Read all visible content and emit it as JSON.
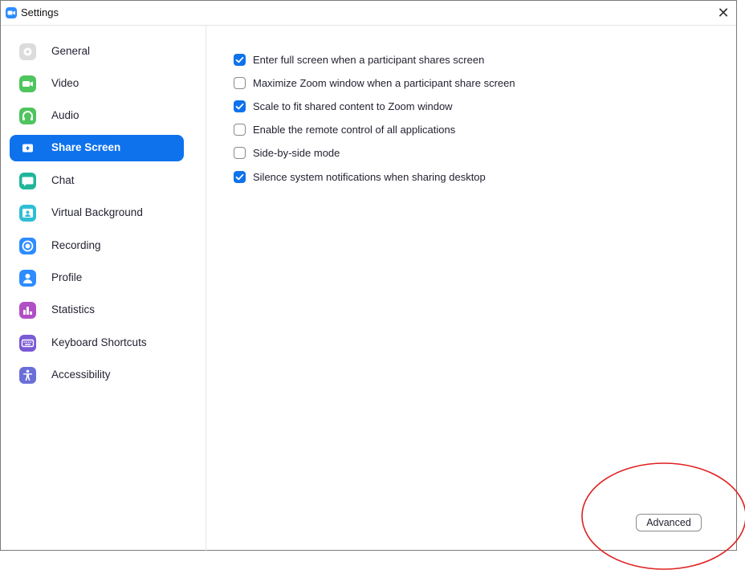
{
  "window": {
    "title": "Settings",
    "close_glyph": "✕"
  },
  "sidebar": {
    "active_index": 3,
    "items": [
      {
        "label": "General",
        "icon": "gear-icon",
        "color": "#d9d9d9"
      },
      {
        "label": "Video",
        "icon": "video-camera-icon",
        "color": "#4ec55e"
      },
      {
        "label": "Audio",
        "icon": "headphones-icon",
        "color": "#4ec55e"
      },
      {
        "label": "Share Screen",
        "icon": "share-screen-icon",
        "color": "#0e72ed"
      },
      {
        "label": "Chat",
        "icon": "chat-bubble-icon",
        "color": "#1fb69a"
      },
      {
        "label": "Virtual Background",
        "icon": "virtual-background-icon",
        "color": "#2ebfd4"
      },
      {
        "label": "Recording",
        "icon": "recording-icon",
        "color": "#2d8cff"
      },
      {
        "label": "Profile",
        "icon": "profile-icon",
        "color": "#2d8cff"
      },
      {
        "label": "Statistics",
        "icon": "statistics-icon",
        "color": "#b14fc5"
      },
      {
        "label": "Keyboard Shortcuts",
        "icon": "keyboard-icon",
        "color": "#7a5ad6"
      },
      {
        "label": "Accessibility",
        "icon": "accessibility-icon",
        "color": "#6a6fd8"
      }
    ]
  },
  "share_screen": {
    "options": [
      {
        "label": "Enter full screen when a participant shares screen",
        "checked": true
      },
      {
        "label": "Maximize Zoom window when a participant share screen",
        "checked": false
      },
      {
        "label": "Scale to fit shared content to Zoom window",
        "checked": true
      },
      {
        "label": "Enable the remote control of all applications",
        "checked": false
      },
      {
        "label": "Side-by-side mode",
        "checked": false
      },
      {
        "label": "Silence system notifications when sharing desktop",
        "checked": true
      }
    ],
    "advanced_label": "Advanced"
  },
  "colors": {
    "accent": "#0e72ed",
    "annotation": "#e02020"
  }
}
